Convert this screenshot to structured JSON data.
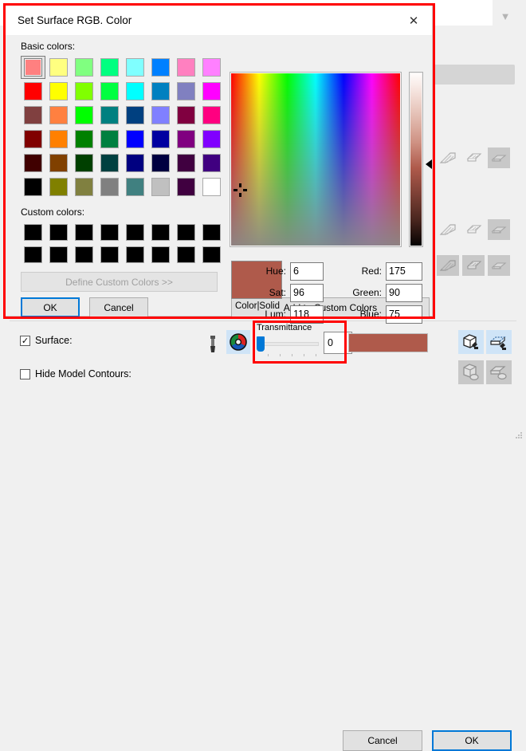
{
  "dialog": {
    "title": "Set Surface RGB. Color",
    "close_icon": "close-icon",
    "basic_colors_label": "Basic colors:",
    "custom_colors_label": "Custom colors:",
    "define_custom_label": "Define Custom Colors >>",
    "ok_label": "OK",
    "cancel_label": "Cancel",
    "add_custom_label": "Add to Custom Colors",
    "preview_label": "Color|Solid",
    "preview_color": "#af5a4b",
    "selected_swatch_index": 0,
    "basic_colors": [
      "#ff8080",
      "#ffff80",
      "#80ff80",
      "#00ff80",
      "#80ffff",
      "#0080ff",
      "#ff80c0",
      "#ff80ff",
      "#ff0000",
      "#ffff00",
      "#80ff00",
      "#00ff40",
      "#00ffff",
      "#0080c0",
      "#8080c0",
      "#ff00ff",
      "#804040",
      "#ff8040",
      "#00ff00",
      "#008080",
      "#004080",
      "#8080ff",
      "#800040",
      "#ff0080",
      "#800000",
      "#ff8000",
      "#008000",
      "#008040",
      "#0000ff",
      "#0000a0",
      "#800080",
      "#8000ff",
      "#400000",
      "#804000",
      "#004000",
      "#004040",
      "#000080",
      "#000040",
      "#400040",
      "#400080",
      "#000000",
      "#808000",
      "#808040",
      "#808080",
      "#408080",
      "#c0c0c0",
      "#400040",
      "#ffffff"
    ],
    "custom_colors": [
      "#000000",
      "#000000",
      "#000000",
      "#000000",
      "#000000",
      "#000000",
      "#000000",
      "#000000",
      "#000000",
      "#000000",
      "#000000",
      "#000000",
      "#000000",
      "#000000",
      "#000000",
      "#000000"
    ],
    "fields": {
      "hue": {
        "label": "Hue:",
        "value": "6"
      },
      "sat": {
        "label": "Sat:",
        "value": "96"
      },
      "lum": {
        "label": "Lum:",
        "value": "118"
      },
      "red": {
        "label": "Red:",
        "value": "175"
      },
      "green": {
        "label": "Green:",
        "value": "90"
      },
      "blue": {
        "label": "Blue:",
        "value": "75"
      }
    }
  },
  "lower_panel": {
    "surface_checkbox": {
      "label": "Surface:",
      "checked": true,
      "check_glyph": "✓"
    },
    "hide_contours_checkbox": {
      "label": "Hide Model Contours:",
      "checked": false,
      "check_glyph": ""
    },
    "dropper_icon": "eyedropper-icon",
    "color_wheel_icon": "color-wheel-icon",
    "transmittance": {
      "label": "Transmittance",
      "value": "0",
      "slider_position_percent": 0
    },
    "surface_color_swatch": "#af5a4b",
    "icon_buttons": [
      {
        "name": "fill-surface-button",
        "state": "enabled"
      },
      {
        "name": "fill-slab-button",
        "state": "enabled"
      },
      {
        "name": "clear-surface-button",
        "state": "disabled"
      },
      {
        "name": "clear-slab-button",
        "state": "disabled"
      }
    ],
    "cancel_label": "Cancel",
    "ok_label": "OK"
  },
  "background_window": {
    "chevron_icon": "chevron-down-icon",
    "hatch_icons": [
      [
        "hatch-triangle-icon",
        "hatch-slab-icon",
        "hatch-flat-icon"
      ],
      [
        "hatch-triangle-icon",
        "hatch-slab-icon",
        "hatch-flat-icon"
      ],
      [
        "hatch-triangle-icon",
        "hatch-slab-icon",
        "hatch-flat-icon"
      ]
    ]
  },
  "annotations": {
    "dialog_highlight_color": "#ff0000",
    "transmittance_highlight_color": "#ff0000"
  }
}
